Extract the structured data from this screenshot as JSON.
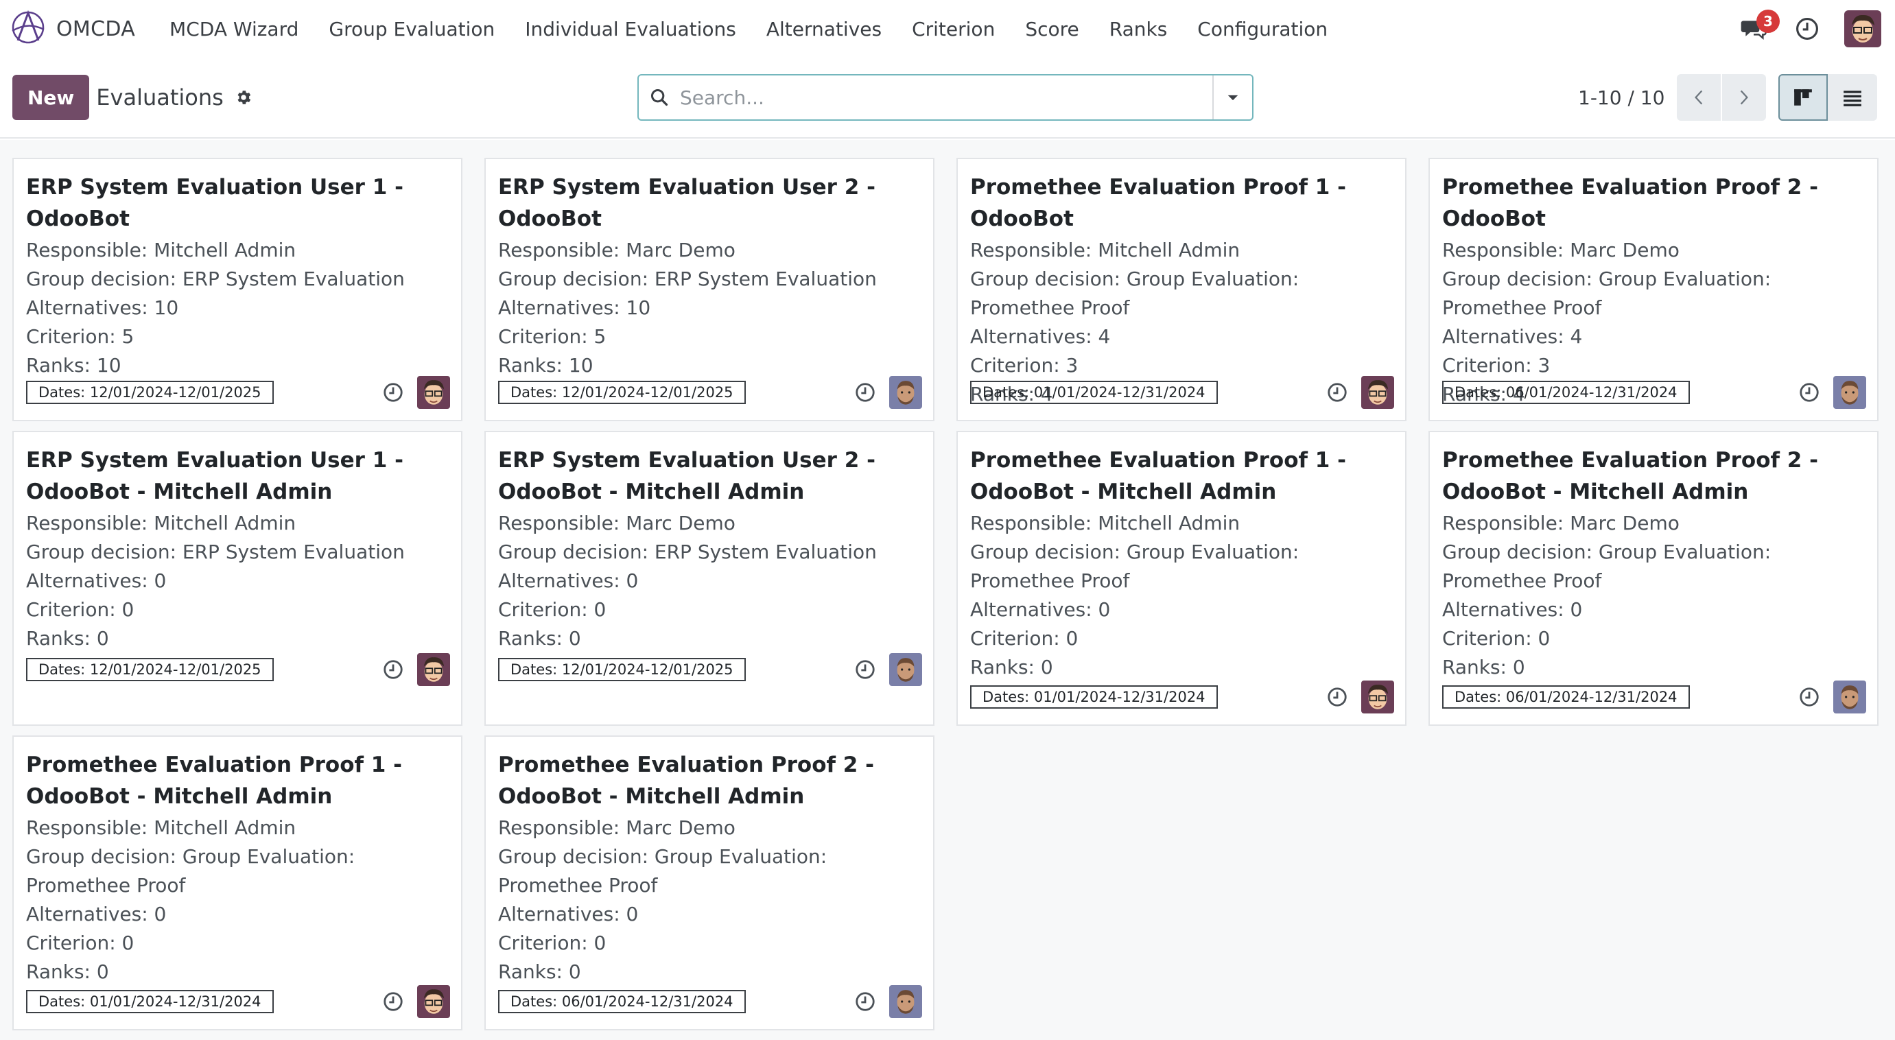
{
  "app": {
    "brand": "OMCDA",
    "menu": [
      "MCDA Wizard",
      "Group Evaluation",
      "Individual Evaluations",
      "Alternatives",
      "Criterion",
      "Score",
      "Ranks",
      "Configuration"
    ],
    "message_count": "3",
    "icons": {
      "brand": "omcda-logo-icon",
      "messages": "chat-icon",
      "activities": "clock-icon"
    }
  },
  "control": {
    "new_label": "New",
    "title": "Evaluations",
    "search_placeholder": "Search...",
    "pager": "1-10 / 10"
  },
  "colors": {
    "primary": "#714b67",
    "search_border": "#74b7bd",
    "badge": "#d63a3a"
  },
  "cards": [
    {
      "title": "ERP System Evaluation User 1 - OdooBot",
      "responsible": "Responsible: Mitchell Admin",
      "group": "Group decision: ERP System Evaluation",
      "alternatives": "Alternatives: 10",
      "criterion": "Criterion: 5",
      "ranks": "Ranks: 10",
      "dates": "Dates: 12/01/2024-12/01/2025",
      "avatar": "mitchell"
    },
    {
      "title": "ERP System Evaluation User 2 - OdooBot",
      "responsible": "Responsible: Marc Demo",
      "group": "Group decision: ERP System Evaluation",
      "alternatives": "Alternatives: 10",
      "criterion": "Criterion: 5",
      "ranks": "Ranks: 10",
      "dates": "Dates: 12/01/2024-12/01/2025",
      "avatar": "marc"
    },
    {
      "title": "Promethee Evaluation Proof 1 - OdooBot",
      "responsible": "Responsible: Mitchell Admin",
      "group": "Group decision: Group Evaluation: Promethee Proof",
      "alternatives": "Alternatives: 4",
      "criterion": "Criterion: 3",
      "ranks": "Ranks: 4",
      "dates": "Dates: 01/01/2024-12/31/2024",
      "avatar": "mitchell"
    },
    {
      "title": "Promethee Evaluation Proof 2 - OdooBot",
      "responsible": "Responsible: Marc Demo",
      "group": "Group decision: Group Evaluation: Promethee Proof",
      "alternatives": "Alternatives: 4",
      "criterion": "Criterion: 3",
      "ranks": "Ranks: 4",
      "dates": "Dates: 06/01/2024-12/31/2024",
      "avatar": "marc"
    },
    {
      "title": "ERP System Evaluation User 1 - OdooBot - Mitchell Admin",
      "responsible": "Responsible: Mitchell Admin",
      "group": "Group decision: ERP System Evaluation",
      "alternatives": "Alternatives: 0",
      "criterion": "Criterion: 0",
      "ranks": "Ranks: 0",
      "dates": "Dates: 12/01/2024-12/01/2025",
      "avatar": "mitchell"
    },
    {
      "title": "ERP System Evaluation User 2 - OdooBot - Mitchell Admin",
      "responsible": "Responsible: Marc Demo",
      "group": "Group decision: ERP System Evaluation",
      "alternatives": "Alternatives: 0",
      "criterion": "Criterion: 0",
      "ranks": "Ranks: 0",
      "dates": "Dates: 12/01/2024-12/01/2025",
      "avatar": "marc"
    },
    {
      "title": "Promethee Evaluation Proof 1 - OdooBot - Mitchell Admin",
      "responsible": "Responsible: Mitchell Admin",
      "group": "Group decision: Group Evaluation: Promethee Proof",
      "alternatives": "Alternatives: 0",
      "criterion": "Criterion: 0",
      "ranks": "Ranks: 0",
      "dates": "Dates: 01/01/2024-12/31/2024",
      "avatar": "mitchell"
    },
    {
      "title": "Promethee Evaluation Proof 2 - OdooBot - Mitchell Admin",
      "responsible": "Responsible: Marc Demo",
      "group": "Group decision: Group Evaluation: Promethee Proof",
      "alternatives": "Alternatives: 0",
      "criterion": "Criterion: 0",
      "ranks": "Ranks: 0",
      "dates": "Dates: 06/01/2024-12/31/2024",
      "avatar": "marc"
    },
    {
      "title": "Promethee Evaluation Proof 1 - OdooBot - Mitchell Admin",
      "responsible": "Responsible: Mitchell Admin",
      "group": "Group decision: Group Evaluation: Promethee Proof",
      "alternatives": "Alternatives: 0",
      "criterion": "Criterion: 0",
      "ranks": "Ranks: 0",
      "dates": "Dates: 01/01/2024-12/31/2024",
      "avatar": "mitchell"
    },
    {
      "title": "Promethee Evaluation Proof 2 - OdooBot - Mitchell Admin",
      "responsible": "Responsible: Marc Demo",
      "group": "Group decision: Group Evaluation: Promethee Proof",
      "alternatives": "Alternatives: 0",
      "criterion": "Criterion: 0",
      "ranks": "Ranks: 0",
      "dates": "Dates: 06/01/2024-12/31/2024",
      "avatar": "marc"
    }
  ]
}
